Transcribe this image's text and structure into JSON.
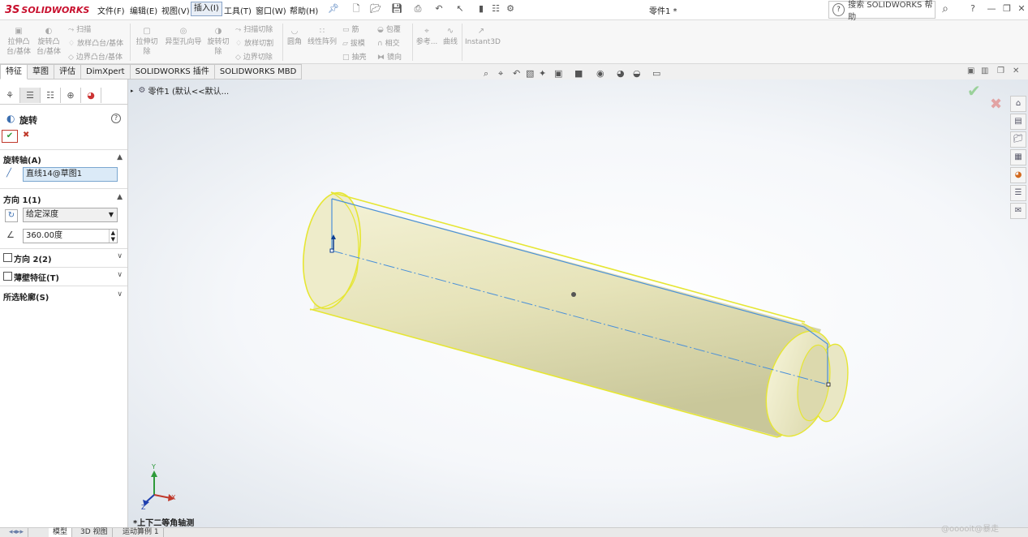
{
  "app": {
    "brand": "SOLIDWORKS",
    "brand_mark": "3S",
    "doc_title": "零件1 *"
  },
  "menu": [
    "文件(F)",
    "编辑(E)",
    "视图(V)",
    "插入(I)",
    "工具(T)",
    "窗口(W)",
    "帮助(H)"
  ],
  "search": {
    "label": "搜索 SOLIDWORKS 帮助"
  },
  "ribbon": {
    "extrude_boss": "拉伸凸台/基体",
    "revolve_boss": "旋转凸台/基体",
    "sweep": "扫描",
    "loft": "放样凸台/基体",
    "boundary_boss": "边界凸台/基体",
    "extrude_cut": "拉伸切除",
    "hole_wizard": "异型孔向导",
    "revolve_cut": "旋转切除",
    "swept_cut": "扫描切除",
    "lofted_cut": "放样切割",
    "boundary_cut": "边界切除",
    "fillet": "圆角",
    "linear_pattern": "线性阵列",
    "rib": "筋",
    "draft": "拔模",
    "shell": "抽壳",
    "wrap": "包覆",
    "intersect": "相交",
    "mirror": "镜向",
    "reference": "参考...",
    "curves": "曲线",
    "instant3d": "Instant3D"
  },
  "tabs": [
    "特征",
    "草图",
    "评估",
    "DimXpert",
    "SOLIDWORKS 插件",
    "SOLIDWORKS MBD"
  ],
  "property_manager": {
    "title": "旋转",
    "axis_section": "旋转轴(A)",
    "axis_value": "直线14@草图1",
    "dir1_section": "方向 1(1)",
    "end_condition": "给定深度",
    "angle_value": "360.00度",
    "dir2_section": "方向 2(2)",
    "thin_section": "薄壁特征(T)",
    "contours_section": "所选轮廓(S)"
  },
  "tree": {
    "root": "零件1 (默认<<默认..."
  },
  "view": {
    "orientation_label": "*上下二等角轴测"
  },
  "bottom_tabs": [
    "模型",
    "3D 视图",
    "运动算例 1"
  ],
  "watermark": "@ooooit@暴走",
  "triad": {
    "x": "X",
    "y": "Y",
    "z": "Z"
  },
  "colors": {
    "model_fill": "#e8e6b8",
    "edge_highlight": "#e6e633",
    "axis_line": "#4a90d9",
    "accept": "#2e9a3a",
    "cancel": "#c0392b"
  }
}
